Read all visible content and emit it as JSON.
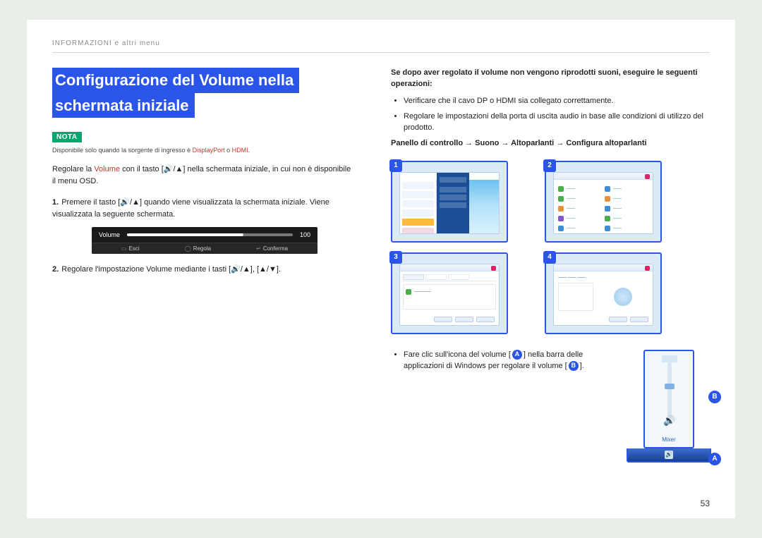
{
  "header": {
    "breadcrumb": "INFORMAZIONI e altri menu"
  },
  "title": {
    "line1": "Configurazione del Volume nella",
    "line2": "schermata iniziale"
  },
  "nota_label": "NOTA",
  "availability_note": {
    "pre": "Disponibile solo quando la sorgente di ingresso è ",
    "dp": "DisplayPort",
    "mid": " o ",
    "hdmi": "HDMI",
    "post": "."
  },
  "intro": {
    "pre": "Regolare la ",
    "vol": "Volume",
    "post": " con il tasto [🔊/▲] nella schermata iniziale, in cui non è disponibile il menu OSD."
  },
  "step1": {
    "num": "1.",
    "text": "Premere il tasto [🔊/▲] quando viene visualizzata la schermata iniziale. Viene visualizzata la seguente schermata."
  },
  "osd": {
    "label": "Volume",
    "value": "100",
    "esci": "Esci",
    "regola": "Regola",
    "conferma": "Conferma"
  },
  "step2": {
    "num": "2.",
    "pre": "Regolare l'impostazione ",
    "vol": "Volume",
    "post": " mediante i tasti [🔊/▲], [▲/▼]."
  },
  "right_intro": "Se dopo aver regolato il volume non vengono riprodotti suoni, eseguire le seguenti operazioni:",
  "bullet1": "Verificare che il cavo DP o HDMI sia collegato correttamente.",
  "bullet2": "Regolare le impostazioni della porta di uscita audio in base alle condizioni di utilizzo del prodotto.",
  "path": "Panello di controllo → Suono → Altoparlanti → Configura altoparlanti",
  "panel_nums": {
    "p1": "1",
    "p2": "2",
    "p3": "3",
    "p4": "4"
  },
  "bottom": {
    "pre": "Fare clic sull'icona del volume [",
    "a": "A",
    "mid": "] nella barra delle applicazioni di Windows per regolare il volume [",
    "b": "B",
    "post": "]."
  },
  "mixer_label": "Mixer",
  "side_labels": {
    "a": "A",
    "b": "B"
  },
  "page_number": "53"
}
